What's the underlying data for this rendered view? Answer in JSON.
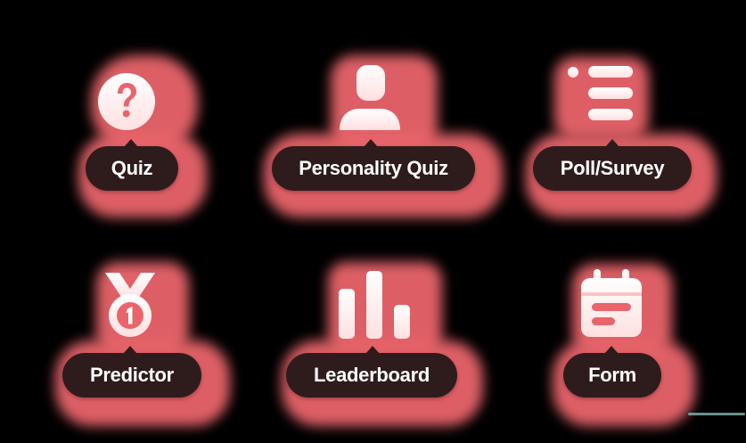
{
  "tiles": [
    {
      "key": "quiz",
      "label": "Quiz",
      "icon": "question-icon"
    },
    {
      "key": "personality-quiz",
      "label": "Personality Quiz",
      "icon": "person-icon"
    },
    {
      "key": "poll-survey",
      "label": "Poll/Survey",
      "icon": "list-icon"
    },
    {
      "key": "predictor",
      "label": "Predictor",
      "icon": "medal-icon"
    },
    {
      "key": "leaderboard",
      "label": "Leaderboard",
      "icon": "bar-chart-icon"
    },
    {
      "key": "form",
      "label": "Form",
      "icon": "calendar-form-icon"
    }
  ],
  "colors": {
    "background": "#000000",
    "glow": "#e9656b",
    "pill": "#2e1c1d",
    "pill_text": "#ffffff",
    "icon_light": "#fff1f1",
    "icon_dark": "#e9656b"
  }
}
